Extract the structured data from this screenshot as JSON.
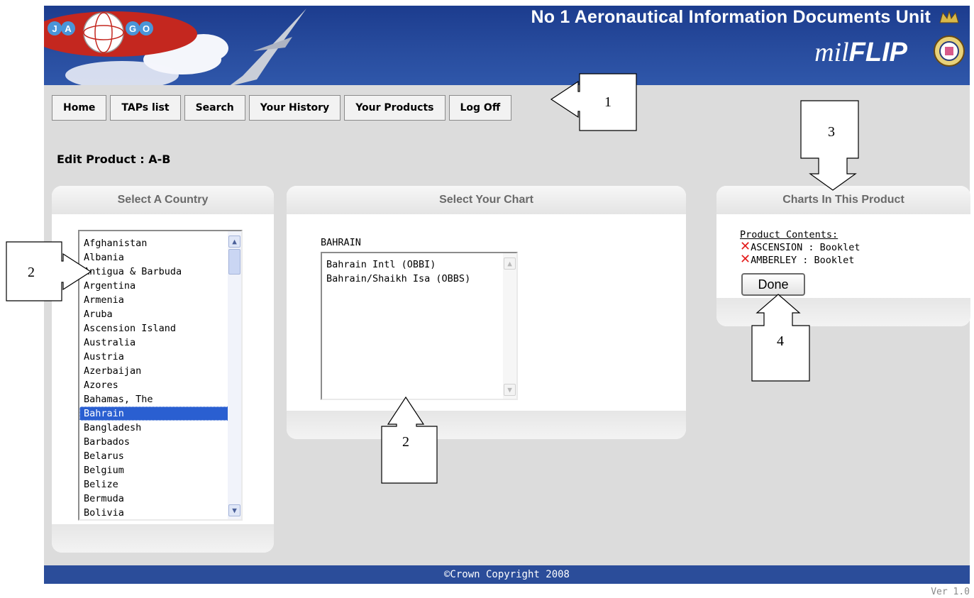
{
  "header": {
    "title": "No 1 Aeronautical Information Documents Unit",
    "brand_prefix": "mil",
    "brand_suffix": "FLIP",
    "logo_letters": [
      "J",
      "A",
      "G",
      "O"
    ]
  },
  "nav": {
    "items": [
      "Home",
      "TAPs list",
      "Search",
      "Your History",
      "Your Products",
      "Log Off"
    ]
  },
  "page_title": "Edit Product : A-B",
  "country_panel": {
    "heading": "Select A Country",
    "countries": [
      "Afghanistan",
      "Albania",
      "Antigua & Barbuda",
      "Argentina",
      "Armenia",
      "Aruba",
      "Ascension Island",
      "Australia",
      "Austria",
      "Azerbaijan",
      "Azores",
      "Bahamas, The",
      "Bahrain",
      "Bangladesh",
      "Barbados",
      "Belarus",
      "Belgium",
      "Belize",
      "Bermuda",
      "Bolivia"
    ],
    "selected": "Bahrain"
  },
  "chart_panel": {
    "heading": "Select Your Chart",
    "country_label": "BAHRAIN",
    "charts": [
      "Bahrain Intl (OBBI)",
      "Bahrain/Shaikh Isa (OBBS)"
    ]
  },
  "product_panel": {
    "heading": "Charts In This Product",
    "contents_label": "Product Contents:",
    "items": [
      "ASCENSION : Booklet",
      "AMBERLEY : Booklet"
    ],
    "remove_icon": "red-x-icon",
    "done_label": "Done"
  },
  "callouts": [
    "1",
    "2",
    "2",
    "3",
    "4"
  ],
  "footer": {
    "copyright": "©Crown Copyright 2008",
    "version": "Ver 1.0"
  },
  "colors": {
    "banner": "#1c3c8e",
    "footer": "#2b4d9a",
    "selection": "#2a5fd1",
    "remove": "#e41c1c"
  }
}
